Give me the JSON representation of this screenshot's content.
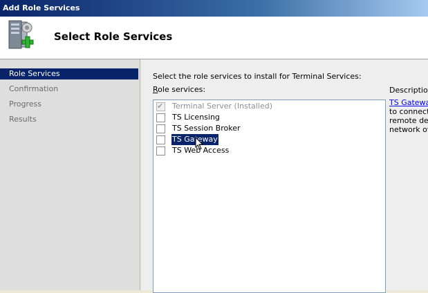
{
  "window": {
    "title": "Add Role Services"
  },
  "header": {
    "title": "Select Role Services",
    "icon": "server-add-icon"
  },
  "sidebar": {
    "items": [
      {
        "label": "Role Services",
        "active": true
      },
      {
        "label": "Confirmation",
        "active": false
      },
      {
        "label": "Progress",
        "active": false
      },
      {
        "label": "Results",
        "active": false
      }
    ]
  },
  "main": {
    "instruction": "Select the role services to install for Terminal Services:",
    "list_label_accel": "R",
    "list_label_rest": "ole services:",
    "role_services": [
      {
        "label": "Terminal Server  (Installed)",
        "checked": true,
        "disabled": true
      },
      {
        "label": "TS Licensing",
        "checked": false,
        "disabled": false
      },
      {
        "label": "TS Session Broker",
        "checked": false,
        "disabled": false
      },
      {
        "label": "TS Gateway",
        "checked": false,
        "disabled": false,
        "selected": true
      },
      {
        "label": "TS Web Access",
        "checked": false,
        "disabled": false
      }
    ],
    "description": {
      "title": "Descriptio",
      "link": "TS Gatewa",
      "lines": [
        "to connect",
        "remote des",
        "network ov"
      ]
    }
  },
  "colors": {
    "selection": "#0a246a",
    "link": "#0000ee"
  }
}
